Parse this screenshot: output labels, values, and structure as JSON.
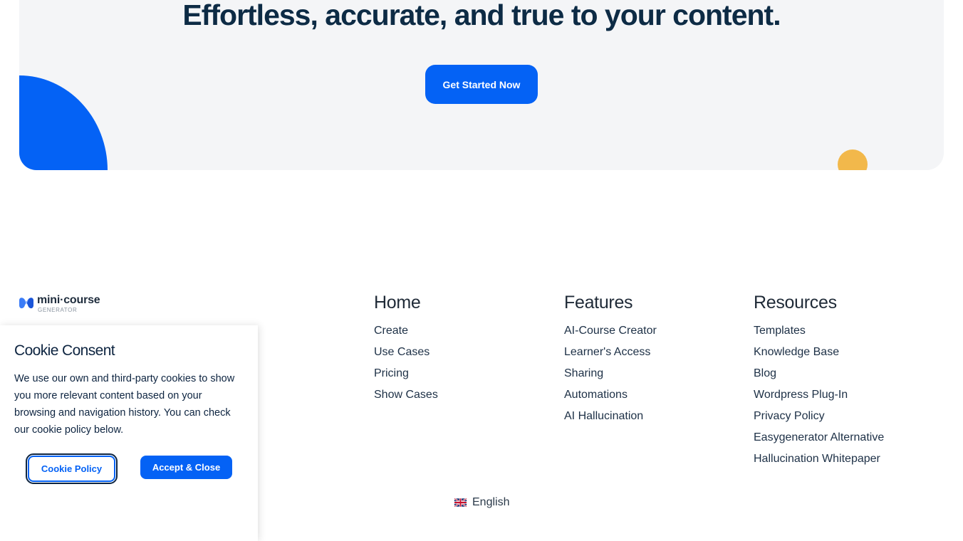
{
  "hero": {
    "title": "Effortless, accurate, and true to your content.",
    "cta_label": "Get Started Now"
  },
  "colors": {
    "brand_blue": "#0462f5",
    "accent_yellow": "#f2b84b",
    "heading_navy": "#0d2b45"
  },
  "logo": {
    "main": "mini·course",
    "sub": "GENERATOR",
    "icon": "mini-course-generator-logo-icon"
  },
  "footer": {
    "home": {
      "heading": "Home",
      "links": [
        "Create",
        "Use Cases",
        "Pricing",
        "Show Cases"
      ]
    },
    "features": {
      "heading": "Features",
      "links": [
        "AI-Course Creator",
        "Learner's Access",
        "Sharing",
        "Automations",
        "AI Hallucination"
      ]
    },
    "resources": {
      "heading": "Resources",
      "links": [
        "Templates",
        "Knowledge Base",
        "Blog",
        "Wordpress Plug-In",
        "Privacy Policy",
        "Easygenerator Alternative",
        "Hallucination Whitepaper"
      ]
    }
  },
  "language": {
    "label": "English",
    "icon": "uk-flag-icon"
  },
  "cookie": {
    "title": "Cookie Consent",
    "body": "We use our own and third-party cookies to show you more relevant content based on your browsing and navigation history. You can check our cookie policy below.",
    "policy_label": "Cookie Policy",
    "accept_label": "Accept & Close"
  }
}
